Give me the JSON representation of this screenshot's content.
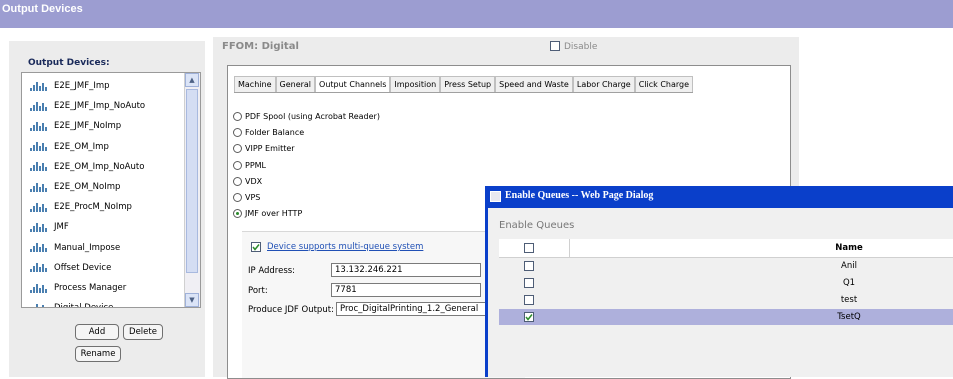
{
  "app": {
    "title": "Output Devices"
  },
  "left": {
    "heading": "Output Devices:",
    "devices": [
      "E2E_JMF_Imp",
      "E2E_JMF_Imp_NoAuto",
      "E2E_JMF_NoImp",
      "E2E_OM_Imp",
      "E2E_OM_Imp_NoAuto",
      "E2E_OM_NoImp",
      "E2E_ProcM_NoImp",
      "JMF",
      "Manual_Impose",
      "Offset Device",
      "Process Manager",
      "Digital Device"
    ],
    "buttons": {
      "add": "Add",
      "delete": "Delete",
      "rename": "Rename"
    }
  },
  "main": {
    "device_title": "FFOM: Digital",
    "disable_label": "Disable",
    "tabs": [
      "Machine",
      "General",
      "Output Channels",
      "Imposition",
      "Press Setup",
      "Speed and Waste",
      "Labor Charge",
      "Click Charge"
    ],
    "active_tab": "Output Channels",
    "channels": [
      "PDF Spool (using Acrobat Reader)",
      "Folder Balance",
      "VIPP Emitter",
      "PPML",
      "VDX",
      "VPS",
      "JMF over HTTP"
    ],
    "selected_channel": "JMF over HTTP",
    "multi_queue_label": "Device supports multi-queue system",
    "fields": {
      "ip_label": "IP Address:",
      "ip_value": "13.132.246.221",
      "port_label": "Port:",
      "port_value": "7781",
      "jdf_label": "Produce JDF Output:",
      "jdf_value": "Proc_DigitalPrinting_1.2_General"
    }
  },
  "dialog": {
    "title": "Enable Queues -- Web Page Dialog",
    "heading": "Enable Queues",
    "column_name": "Name",
    "queues": [
      {
        "name": "Anil",
        "checked": false
      },
      {
        "name": "Q1",
        "checked": false
      },
      {
        "name": "test",
        "checked": false
      },
      {
        "name": "TsetQ",
        "checked": true
      }
    ]
  },
  "colors": {
    "title_bar": "#9c9dd1",
    "dialog_title": "#0a3fca",
    "selected_row": "#aeb0dc",
    "link": "#2050b5"
  }
}
